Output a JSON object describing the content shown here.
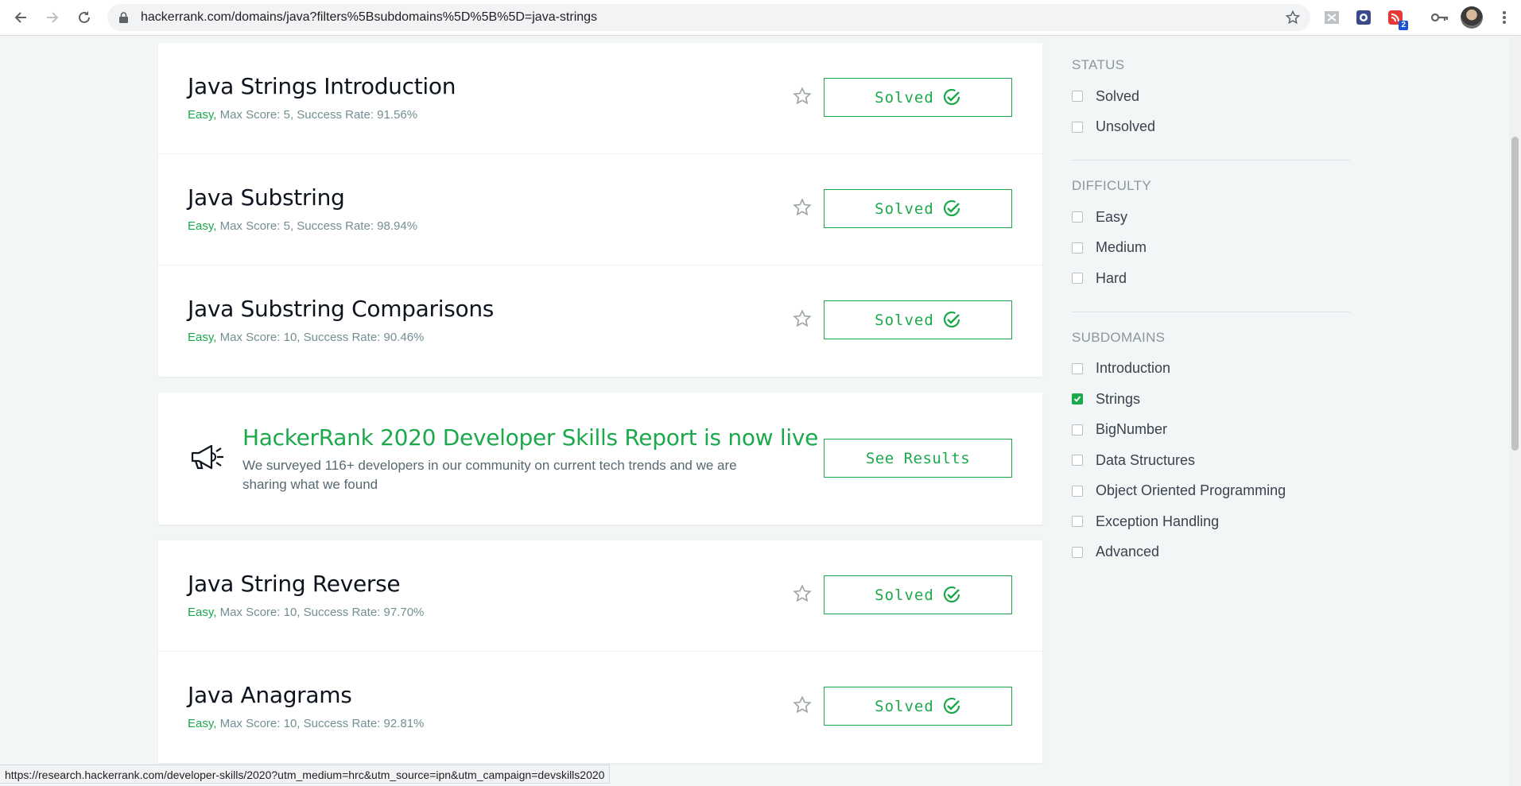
{
  "browser": {
    "url": "hackerrank.com/domains/java?filters%5Bsubdomains%5D%5B%5D=java-strings",
    "extension_badge": "2"
  },
  "challenges_top": [
    {
      "title": "Java Strings Introduction",
      "difficulty": "Easy,",
      "meta": " Max Score: 5, Success Rate: 91.56%",
      "button": "Solved"
    },
    {
      "title": "Java Substring",
      "difficulty": "Easy,",
      "meta": " Max Score: 5, Success Rate: 98.94%",
      "button": "Solved"
    },
    {
      "title": "Java Substring Comparisons",
      "difficulty": "Easy,",
      "meta": " Max Score: 10, Success Rate: 90.46%",
      "button": "Solved"
    }
  ],
  "promo": {
    "title": "HackerRank 2020 Developer Skills Report is now live",
    "description": "We surveyed 116+ developers in our community on current tech trends and we are sharing what we found",
    "button": "See Results"
  },
  "challenges_bottom": [
    {
      "title": "Java String Reverse",
      "difficulty": "Easy,",
      "meta": " Max Score: 10, Success Rate: 97.70%",
      "button": "Solved"
    },
    {
      "title": "Java Anagrams",
      "difficulty": "Easy,",
      "meta": " Max Score: 10, Success Rate: 92.81%",
      "button": "Solved"
    }
  ],
  "filters": {
    "status": {
      "heading": "STATUS",
      "options": [
        "Solved",
        "Unsolved"
      ]
    },
    "difficulty": {
      "heading": "DIFFICULTY",
      "options": [
        "Easy",
        "Medium",
        "Hard"
      ]
    },
    "subdomains": {
      "heading": "SUBDOMAINS",
      "options": [
        "Introduction",
        "Strings",
        "BigNumber",
        "Data Structures",
        "Object Oriented Programming",
        "Exception Handling",
        "Advanced"
      ],
      "checked": "Strings"
    }
  },
  "statusbar": {
    "text": "https://research.hackerrank.com/developer-skills/2020?utm_medium=hrc&utm_source=ipn&utm_campaign=devskills2020"
  },
  "colors": {
    "accent": "#1ba94c",
    "title": "#0e141e",
    "meta": "#738f93"
  }
}
